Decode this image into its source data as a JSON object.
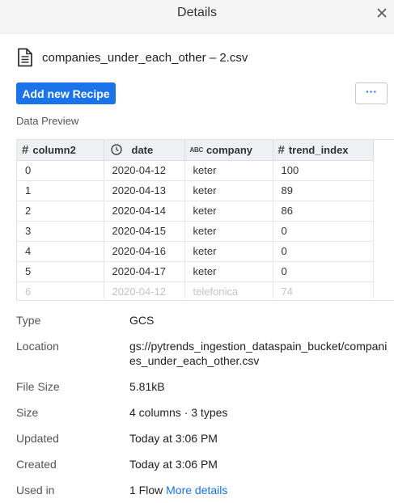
{
  "header": {
    "title": "Details"
  },
  "file": {
    "name": "companies_under_each_other – 2.csv"
  },
  "actions": {
    "add_recipe_label": "Add new Recipe",
    "more_label": "···"
  },
  "preview": {
    "label": "Data Preview",
    "columns": [
      {
        "name": "column2",
        "type_icon": "hash-icon",
        "type_glyph": "#"
      },
      {
        "name": "date",
        "type_icon": "clock-icon",
        "type_glyph": ""
      },
      {
        "name": "company",
        "type_icon": "abc-icon",
        "type_glyph": "ABC"
      },
      {
        "name": "trend_index",
        "type_icon": "hash-icon",
        "type_glyph": "#"
      }
    ],
    "rows": [
      [
        "0",
        "2020-04-12",
        "keter",
        "100"
      ],
      [
        "1",
        "2020-04-13",
        "keter",
        "89"
      ],
      [
        "2",
        "2020-04-14",
        "keter",
        "86"
      ],
      [
        "3",
        "2020-04-15",
        "keter",
        "0"
      ],
      [
        "4",
        "2020-04-16",
        "keter",
        "0"
      ],
      [
        "5",
        "2020-04-17",
        "keter",
        "0"
      ],
      [
        "6",
        "2020-04-12",
        "telefonica",
        "74"
      ]
    ]
  },
  "meta": [
    {
      "key": "Type",
      "value": "GCS"
    },
    {
      "key": "Location",
      "value": "gs://pytrends_ingestion_dataspain_bucket/companies_under_each_other.csv"
    },
    {
      "key": "File Size",
      "value": "5.81kB"
    },
    {
      "key": "Size",
      "value": "4 columns · 3 types"
    },
    {
      "key": "Updated",
      "value": "Today at 3:06 PM"
    },
    {
      "key": "Created",
      "value": "Today at 3:06 PM"
    },
    {
      "key": "Used in",
      "value": "1 Flow",
      "link": "More details"
    }
  ],
  "colors": {
    "accent": "#1a73e8",
    "header_bg": "#f5f5f5",
    "table_header_bg": "#eef0f3"
  }
}
